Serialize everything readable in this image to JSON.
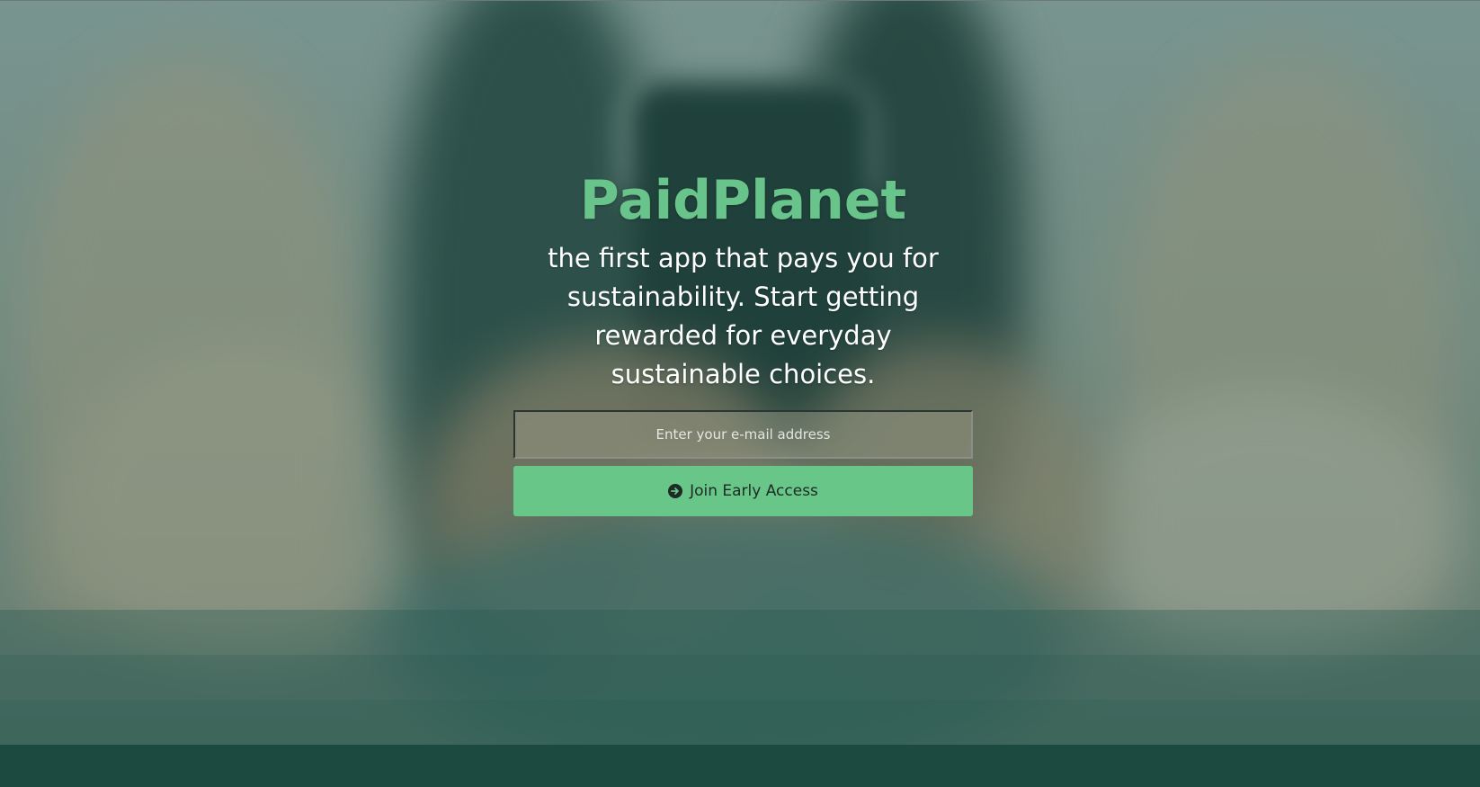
{
  "hero": {
    "brand": "PaidPlanet",
    "tagline": "the first app that pays you for sustainability. Start getting rewarded for everyday sustainable choices."
  },
  "signup": {
    "email_placeholder": "Enter your e-mail address",
    "email_value": "",
    "button_label": "Join Early Access",
    "button_icon": "arrow-circle-right-icon"
  },
  "colors": {
    "brand": "#69c48b",
    "button": "#67c688",
    "footer": "#1c4a41"
  }
}
